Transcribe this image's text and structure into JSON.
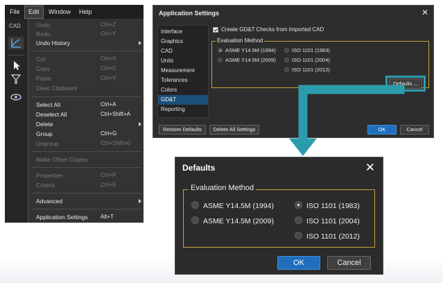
{
  "app": {
    "menubar": {
      "file": "File",
      "edit": "Edit",
      "window": "Window",
      "help": "Help"
    },
    "sidebar_label": "CAD"
  },
  "edit_menu": {
    "items": [
      {
        "label": "Undo",
        "shortcut": "Ctrl+Z",
        "disabled": true
      },
      {
        "label": "Redo",
        "shortcut": "Ctrl+Y",
        "disabled": true
      },
      {
        "label": "Undo History",
        "shortcut": "",
        "disabled": false,
        "submenu": true
      },
      {
        "label": "Cut",
        "shortcut": "Ctrl+X",
        "disabled": true
      },
      {
        "label": "Copy",
        "shortcut": "Ctrl+C",
        "disabled": true
      },
      {
        "label": "Paste",
        "shortcut": "Ctrl+V",
        "disabled": true
      },
      {
        "label": "Clear Clipboard",
        "shortcut": "",
        "disabled": true
      },
      {
        "label": "Select All",
        "shortcut": "Ctrl+A",
        "disabled": false
      },
      {
        "label": "Deselect All",
        "shortcut": "Ctrl+Shift+A",
        "disabled": false
      },
      {
        "label": "Delete",
        "shortcut": "",
        "disabled": false,
        "submenu": true
      },
      {
        "label": "Group",
        "shortcut": "Ctrl+G",
        "disabled": false
      },
      {
        "label": "Ungroup",
        "shortcut": "Ctrl+Shift+G",
        "disabled": true
      },
      {
        "label": "Make Offset Copies",
        "shortcut": "",
        "disabled": true
      },
      {
        "label": "Properties",
        "shortcut": "Ctrl+P",
        "disabled": true
      },
      {
        "label": "Criteria",
        "shortcut": "Ctrl+K",
        "disabled": true
      },
      {
        "label": "Advanced",
        "shortcut": "",
        "disabled": false,
        "submenu": true
      },
      {
        "label": "Application Settings",
        "shortcut": "Alt+T",
        "disabled": false
      }
    ]
  },
  "app_settings": {
    "title": "Application Settings",
    "close": "✕",
    "nav": [
      "Interface",
      "Graphics",
      "CAD",
      "Units",
      "Measurement",
      "Tolerances",
      "Colors",
      "GD&T",
      "Reporting"
    ],
    "selected_nav": "GD&T",
    "checkbox_label": "Create GD&T Checks from Imported CAD",
    "eval_title": "Evaluation Method",
    "options_left": [
      "ASME Y14.5M (1994)",
      "ASME Y14.5M (2009)"
    ],
    "options_right": [
      "ISO 1101 (1983)",
      "ISO 1101 (2004)",
      "ISO 1101 (2012)"
    ],
    "selected": "ASME Y14.5M (1994)",
    "defaults_button": "Defaults ...",
    "restore_button": "Restore Defaults",
    "delete_button": "Delete All Settings",
    "ok": "OK",
    "cancel": "Cancel"
  },
  "defaults_dialog": {
    "title": "Defaults",
    "close": "✕",
    "eval_title": "Evaluation Method",
    "options_left": [
      "ASME Y14.5M (1994)",
      "ASME Y14.5M (2009)"
    ],
    "options_right": [
      "ISO 1101 (1983)",
      "ISO 1101 (2004)",
      "ISO 1101 (2012)"
    ],
    "selected": "ISO 1101 (1983)",
    "ok": "OK",
    "cancel": "Cancel"
  },
  "colors": {
    "accent_blue": "#1f6fbd",
    "highlight_teal": "#2a9cad",
    "group_border": "#c8a23a"
  }
}
